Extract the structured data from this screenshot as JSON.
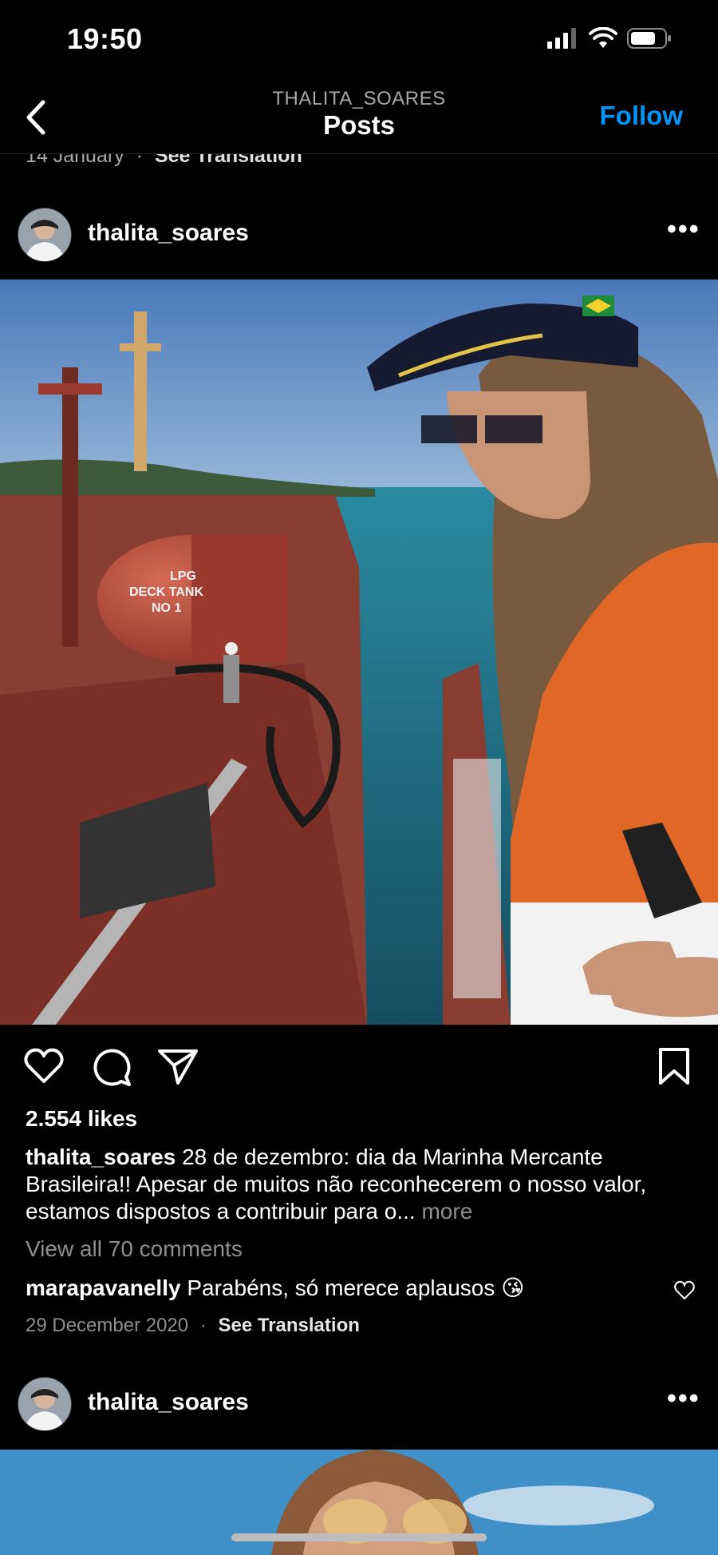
{
  "status_bar": {
    "time": "19:50",
    "icons": [
      "cellular-signal-icon",
      "wifi-icon",
      "battery-icon"
    ]
  },
  "nav": {
    "subtitle": "THALITA_SOARES",
    "title": "Posts",
    "follow_label": "Follow",
    "back_icon": "chevron-left-icon"
  },
  "previous_post": {
    "date": "14 January",
    "separator": "·",
    "translate_label": "See Translation"
  },
  "post": {
    "username": "thalita_soares",
    "more_icon": "more-horizontal-icon",
    "image_text": {
      "tank_line1": "LPG",
      "tank_line2": "DECK TANK",
      "tank_line3": "NO 1"
    },
    "actions": [
      "heart-icon",
      "comment-icon",
      "share-icon",
      "bookmark-icon"
    ],
    "likes": "2.554 likes",
    "caption_user": "thalita_soares",
    "caption_text": "28 de dezembro: dia da Marinha Mercante Brasileira!! Apesar de muitos não reconhecerem o nosso valor, estamos dispostos a contribuir para o...",
    "caption_more": "more",
    "view_all_comments": "View all 70 comments",
    "top_comment": {
      "user": "marapavanelly",
      "text": "Parabéns, só merece aplausos 😘"
    },
    "date": "29 December 2020",
    "separator": "·",
    "translate_label": "See Translation"
  },
  "next_post": {
    "username": "thalita_soares",
    "more_icon": "more-horizontal-icon"
  },
  "colors": {
    "accent": "#0095f6",
    "background": "#000000",
    "muted": "#8e8e8e"
  }
}
